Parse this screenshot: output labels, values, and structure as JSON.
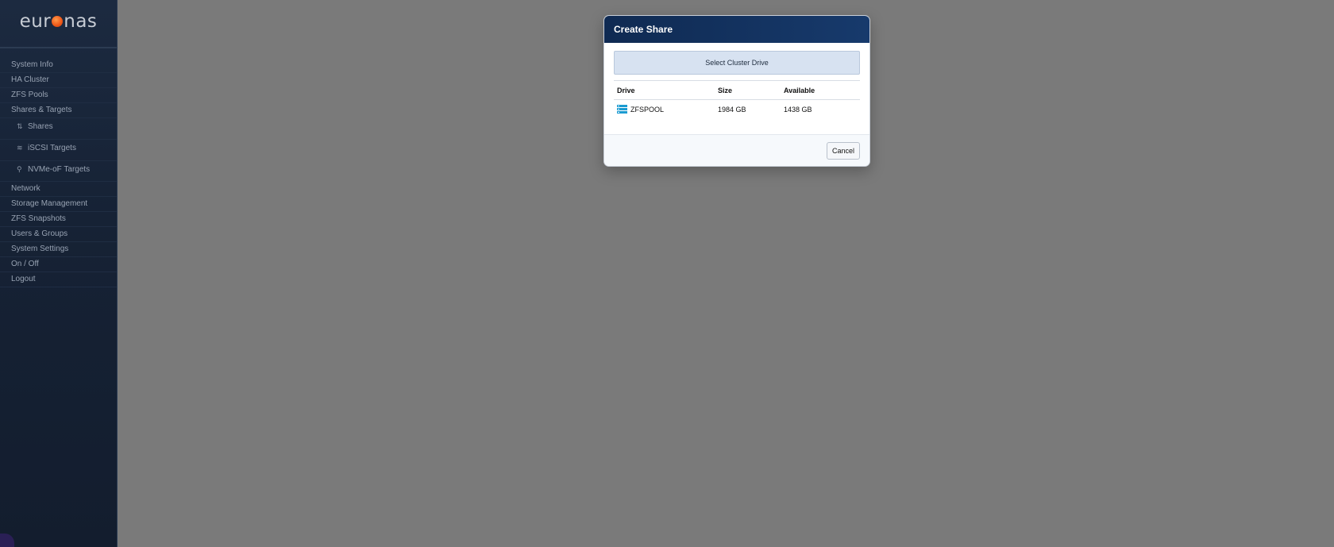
{
  "logo": {
    "text_before": "eur",
    "text_after": "nas"
  },
  "sidebar": {
    "items": [
      {
        "label": "System Info"
      },
      {
        "label": "HA Cluster"
      },
      {
        "label": "ZFS Pools"
      },
      {
        "label": "Shares & Targets"
      }
    ],
    "sub_items": [
      {
        "label": "Shares",
        "icon": "shares-icon"
      },
      {
        "label": "iSCSI Targets",
        "icon": "iscsi-icon"
      },
      {
        "label": "NVMe-oF Targets",
        "icon": "nvme-icon"
      }
    ],
    "items_after": [
      {
        "label": "Network"
      },
      {
        "label": "Storage Management"
      },
      {
        "label": "ZFS Snapshots"
      },
      {
        "label": "Users & Groups"
      },
      {
        "label": "System Settings"
      },
      {
        "label": "On / Off"
      },
      {
        "label": "Logout"
      }
    ]
  },
  "modal": {
    "title": "Create Share",
    "select_label": "Select Cluster Drive",
    "columns": [
      "Drive",
      "Size",
      "Available"
    ],
    "rows": [
      {
        "drive": "ZFSPOOL",
        "size": "1984 GB",
        "available": "1438 GB",
        "icon": "storage-pool-icon"
      }
    ],
    "cancel_label": "Cancel"
  },
  "colors": {
    "sidebar_bg": "#162235",
    "header_bg": "#0f2a52",
    "select_bg": "#d7e2f1",
    "overlay": "#7a7a7a",
    "accent_orange": "#f05a1a"
  }
}
